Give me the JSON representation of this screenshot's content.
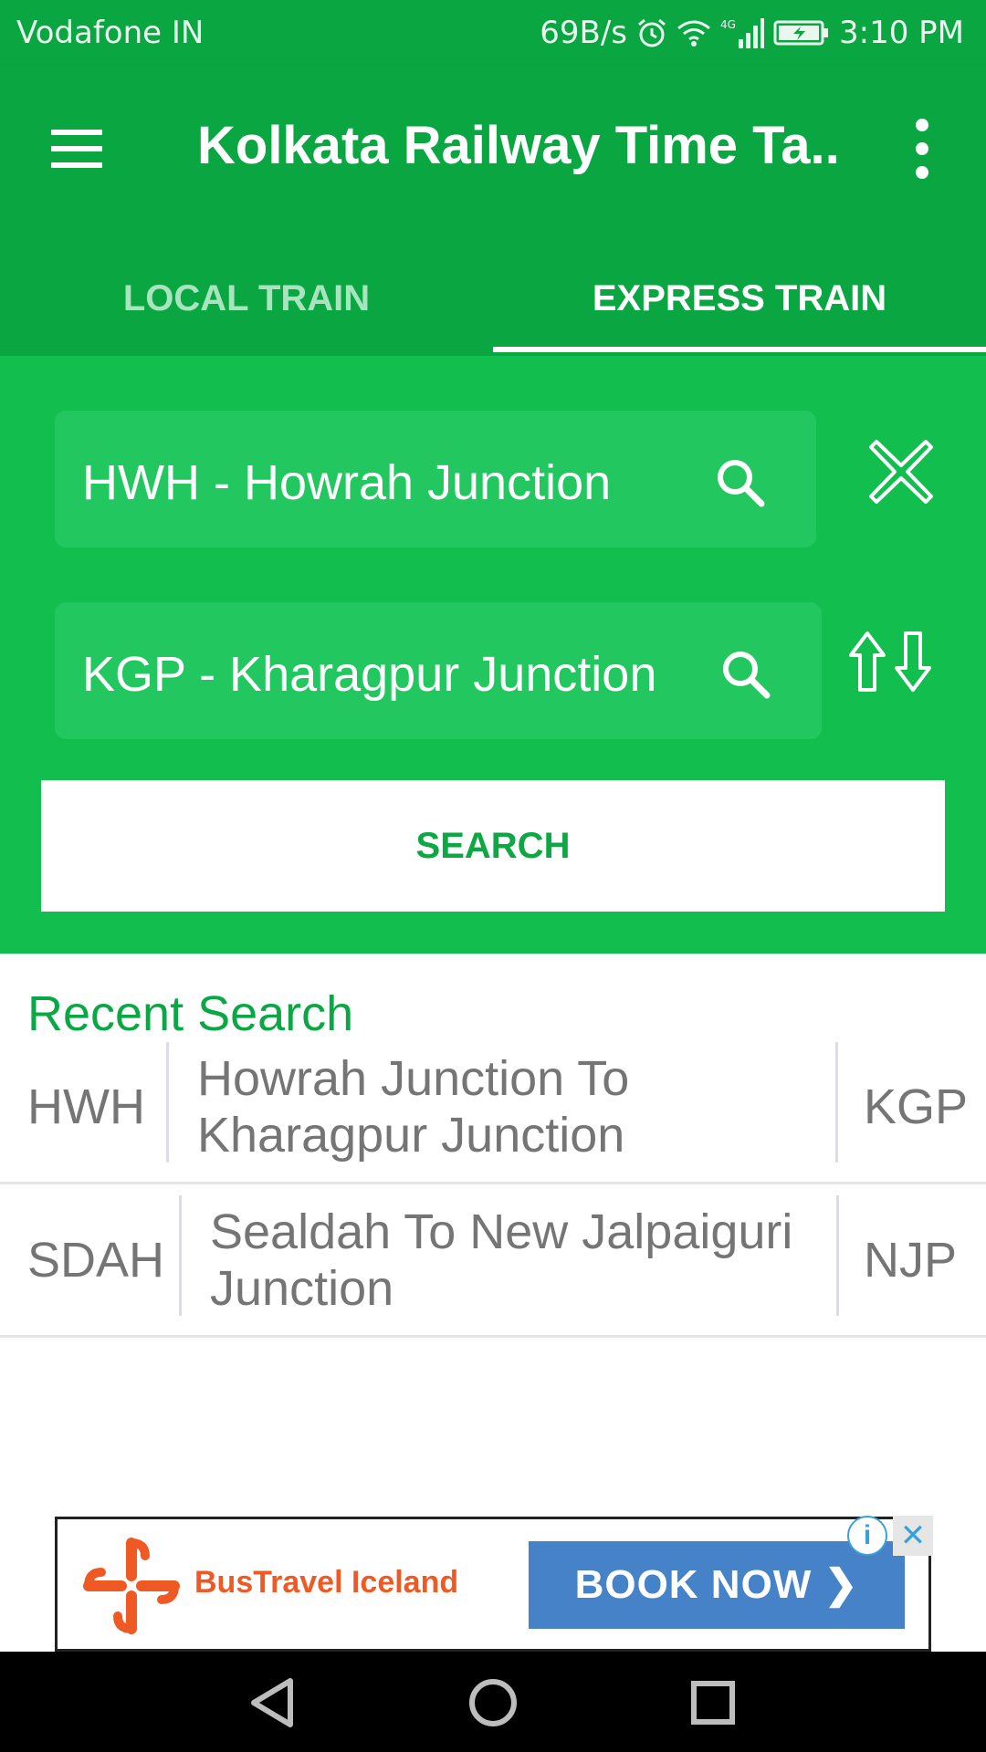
{
  "status_bar": {
    "carrier": "Vodafone IN",
    "data_speed": "69B/s",
    "network": "4G",
    "time": "3:10 PM",
    "icons": [
      "alarm-icon",
      "wifi-icon",
      "signal-icon",
      "battery-charging-icon"
    ]
  },
  "app_bar": {
    "title": "Kolkata Railway Time Ta...",
    "menu_icon": "hamburger-menu-icon",
    "overflow_icon": "more-vertical-icon"
  },
  "tabs": [
    {
      "label": "LOCAL TRAIN",
      "selected": false
    },
    {
      "label": "EXPRESS TRAIN",
      "selected": true
    }
  ],
  "search_form": {
    "from_station": "HWH - Howrah Junction",
    "to_station": "KGP - Kharagpur Junction",
    "search_label": "SEARCH",
    "clear_icon": "close-icon",
    "swap_icon": "swap-arrows-icon"
  },
  "recent_search": {
    "title": "Recent Search",
    "items": [
      {
        "from_code": "HWH",
        "route": "Howrah Junction To Kharagpur Junction",
        "to_code": "KGP"
      },
      {
        "from_code": "SDAH",
        "route": "Sealdah To New Jalpaiguri Junction",
        "to_code": "NJP"
      }
    ]
  },
  "ad": {
    "brand": "BusTravel Iceland",
    "cta": "BOOK NOW",
    "info_icon": "info-icon",
    "close_icon": "close-icon"
  },
  "colors": {
    "primary": "#09a642",
    "panel": "#12be4e",
    "field": "#22c85f",
    "accent_text": "#0aa845",
    "ad_cta": "#4682c8",
    "ad_brand": "#ef5a24"
  }
}
